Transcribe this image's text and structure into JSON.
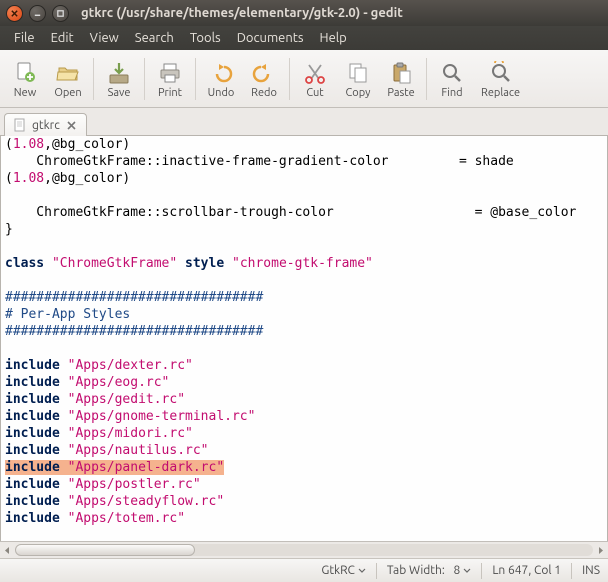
{
  "window": {
    "title": "gtkrc (/usr/share/themes/elementary/gtk-2.0) - gedit"
  },
  "menubar": {
    "items": [
      "File",
      "Edit",
      "View",
      "Search",
      "Tools",
      "Documents",
      "Help"
    ]
  },
  "toolbar": {
    "new": "New",
    "open": "Open",
    "save": "Save",
    "print": "Print",
    "undo": "Undo",
    "redo": "Redo",
    "cut": "Cut",
    "copy": "Copy",
    "paste": "Paste",
    "find": "Find",
    "replace": "Replace"
  },
  "tab": {
    "filename": "gtkrc"
  },
  "editor": {
    "lines": [
      {
        "pre": "(",
        "num": "1.08",
        "mid": ",@bg_color)"
      },
      {
        "indent": "    ",
        "cls": "ChromeGtkFrame",
        "sep": "::",
        "prop": "inactive-frame-gradient-color",
        "pad": "         ",
        "eq": "= ",
        "val": "shade"
      },
      {
        "pre": "(",
        "num": "1.08",
        "mid": ",@bg_color)"
      },
      {
        "blank": true
      },
      {
        "indent": "    ",
        "cls": "ChromeGtkFrame",
        "sep": "::",
        "prop": "scrollbar-trough-color",
        "pad": "                  ",
        "eq": "= ",
        "val": "@base_color"
      },
      {
        "raw": "}"
      },
      {
        "blank": true
      },
      {
        "kw1": "class",
        "sp1": " ",
        "str1": "\"ChromeGtkFrame\"",
        "sp2": " ",
        "kw2": "style",
        "sp3": " ",
        "str2": "\"chrome-gtk-frame\""
      },
      {
        "blank": true
      },
      {
        "comment": "#################################"
      },
      {
        "comment": "# Per-App Styles"
      },
      {
        "comment": "#################################"
      },
      {
        "blank": true
      },
      {
        "inc": "include",
        "sp": " ",
        "path": "\"Apps/dexter.rc\""
      },
      {
        "inc": "include",
        "sp": " ",
        "path": "\"Apps/eog.rc\""
      },
      {
        "inc": "include",
        "sp": " ",
        "path": "\"Apps/gedit.rc\""
      },
      {
        "inc": "include",
        "sp": " ",
        "path": "\"Apps/gnome-terminal.rc\""
      },
      {
        "inc": "include",
        "sp": " ",
        "path": "\"Apps/midori.rc\""
      },
      {
        "inc": "include",
        "sp": " ",
        "path": "\"Apps/nautilus.rc\""
      },
      {
        "inc": "include",
        "sp": " ",
        "path": "\"Apps/panel-dark.rc\"",
        "selected": true
      },
      {
        "inc": "include",
        "sp": " ",
        "path": "\"Apps/postler.rc\""
      },
      {
        "inc": "include",
        "sp": " ",
        "path": "\"Apps/steadyflow.rc\""
      },
      {
        "inc": "include",
        "sp": " ",
        "path": "\"Apps/totem.rc\""
      }
    ]
  },
  "statusbar": {
    "syntax": "GtkRC",
    "tabwidth_label": "Tab Width:",
    "tabwidth_value": "8",
    "position": "Ln 647, Col 1",
    "insert_mode": "INS"
  }
}
